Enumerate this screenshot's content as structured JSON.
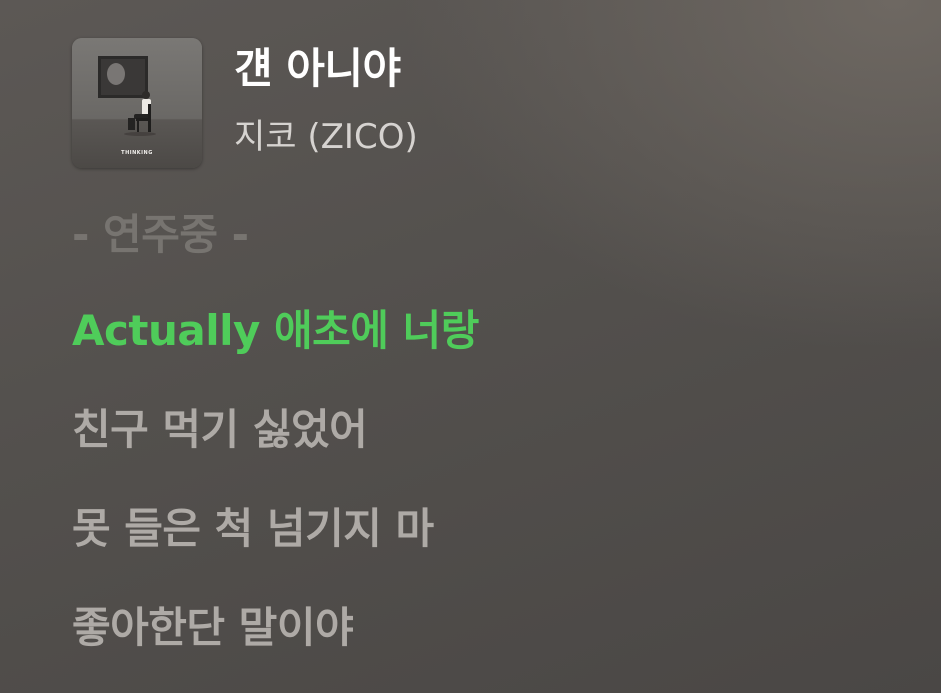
{
  "now_playing": {
    "title": "걘 아니야",
    "artist": "지코 (ZICO)",
    "album_art_label": "THINKING"
  },
  "lyrics": {
    "instrumental_label": "- 연주중 -",
    "lines": [
      "Actually 애초에 너랑",
      "친구 먹기 싫었어",
      "못 들은 척 넘기지 마",
      "좋아한단 말이야"
    ],
    "active_index": 0
  },
  "colors": {
    "active_lyric": "#4fcc5a",
    "inactive_lyric": "#aeaaa6",
    "instrumental": "#777470",
    "title": "#ffffff",
    "artist": "#d6d3d0"
  }
}
